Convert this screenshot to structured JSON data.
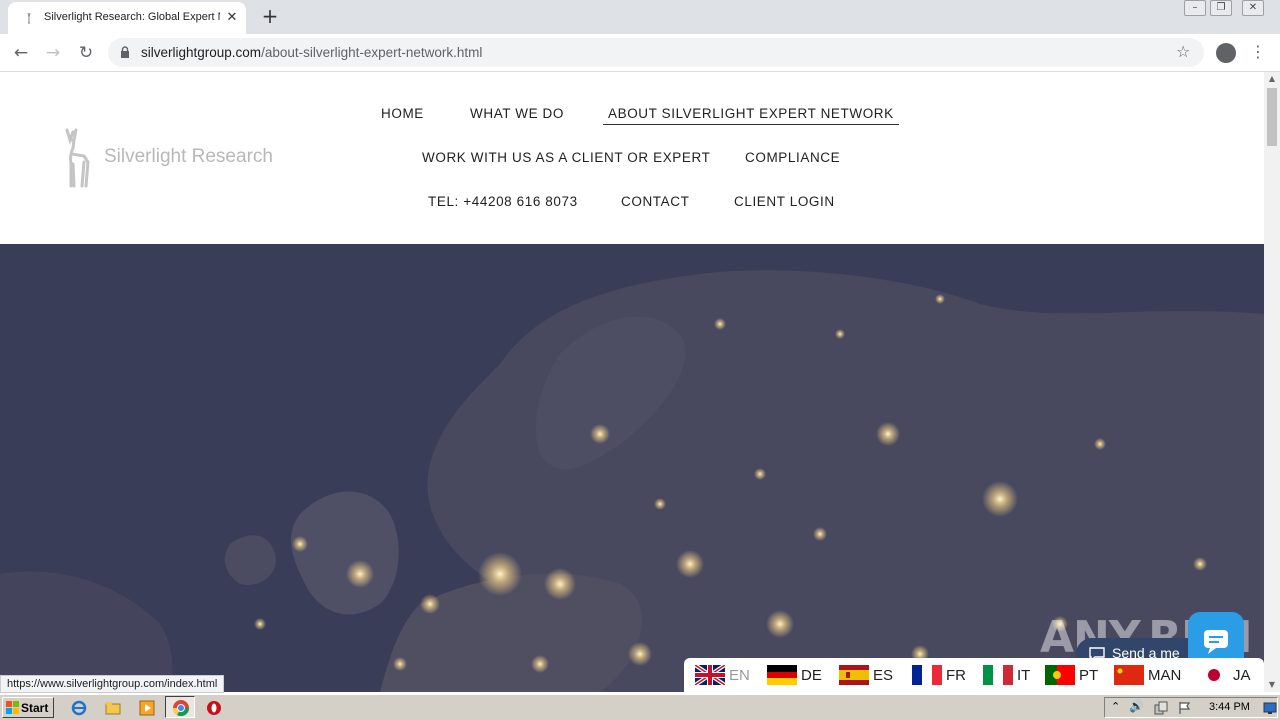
{
  "browser": {
    "tab_title": "Silverlight Research: Global Expert N",
    "url_domain": "silverlightgroup.com",
    "url_path": "/about-silverlight-expert-network.html",
    "status_url": "https://www.silverlightgroup.com/index.html"
  },
  "site": {
    "logo_text": "Silverlight Research",
    "nav": [
      {
        "label": "HOME"
      },
      {
        "label": "WHAT WE DO"
      },
      {
        "label": "ABOUT SILVERLIGHT EXPERT NETWORK",
        "active": true
      },
      {
        "label": "WORK WITH US AS A CLIENT OR EXPERT"
      },
      {
        "label": "COMPLIANCE"
      },
      {
        "label": "TEL: +44208 616 8073"
      },
      {
        "label": "CONTACT"
      },
      {
        "label": "CLIENT LOGIN"
      }
    ]
  },
  "chat": {
    "label": "Send a me"
  },
  "watermark": "ANY.RUN",
  "languages": [
    {
      "code": "EN",
      "icon": "uk-flag-icon"
    },
    {
      "code": "DE",
      "icon": "germany-flag-icon"
    },
    {
      "code": "ES",
      "icon": "spain-flag-icon"
    },
    {
      "code": "FR",
      "icon": "france-flag-icon"
    },
    {
      "code": "IT",
      "icon": "italy-flag-icon"
    },
    {
      "code": "PT",
      "icon": "portugal-flag-icon"
    },
    {
      "code": "MAN",
      "icon": "china-flag-icon"
    },
    {
      "code": "JA",
      "icon": "japan-flag-icon"
    }
  ],
  "taskbar": {
    "start_label": "Start",
    "clock": "3:44 PM"
  }
}
